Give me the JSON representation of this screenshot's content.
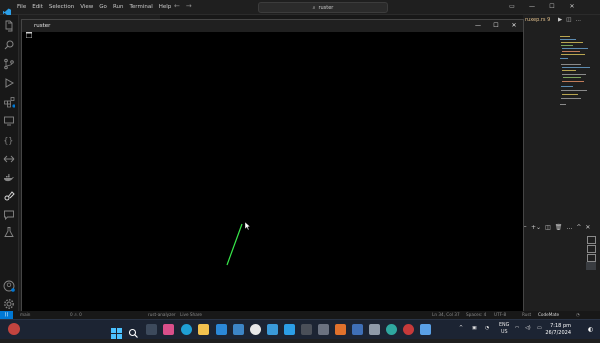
{
  "menu": [
    "File",
    "Edit",
    "Selection",
    "View",
    "Go",
    "Run",
    "Terminal",
    "Help"
  ],
  "search": {
    "text": "ruster"
  },
  "pygame": {
    "title": "ruster",
    "controls": [
      "—",
      "☐",
      "✕"
    ]
  },
  "editor": {
    "tab_file": "ruxep.rs 9"
  },
  "statusbar": {
    "left_items": [
      "main",
      "0 ⚠ 0",
      "rust-analyzer",
      "Live Share",
      "Rust"
    ],
    "cursor": "Ln 34, Col 37",
    "spaces": "Spaces: 4",
    "encoding": "UTF-8",
    "language": "Rust",
    "codemate": "CodeMate"
  },
  "taskbar": {
    "lang": "ENG",
    "region": "US",
    "time": "7:18 pm",
    "date": "26/7/2024"
  },
  "colors": {
    "accent": "#0078d4",
    "line": "#37e84a"
  },
  "icons": {
    "activity": [
      "explorer-icon",
      "search-icon",
      "source-control-icon",
      "run-debug-icon",
      "extensions-icon",
      "remote-explorer-icon",
      "bracket-icon",
      "live-share-icon",
      "docker-icon",
      "chat-icon",
      "testing-icon",
      "account-icon",
      "settings-icon"
    ]
  }
}
